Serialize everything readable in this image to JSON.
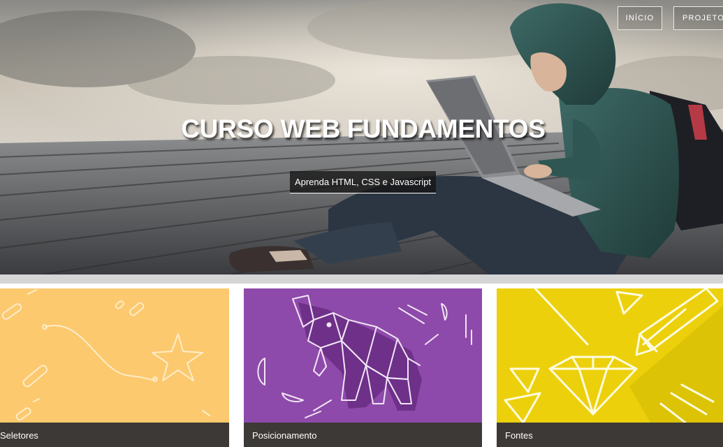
{
  "nav": {
    "items": [
      {
        "label": "INÍCIO"
      },
      {
        "label": "PROJETOS"
      }
    ]
  },
  "hero": {
    "title": "CURSO WEB FUNDAMENTOS",
    "subtitle": "Aprenda HTML, CSS e Javascript"
  },
  "cards": [
    {
      "label": "Seletores",
      "color": "#fcc96f"
    },
    {
      "label": "Posicionamento",
      "color": "#8e4aaa"
    },
    {
      "label": "Fontes",
      "color": "#ecd00c"
    }
  ]
}
